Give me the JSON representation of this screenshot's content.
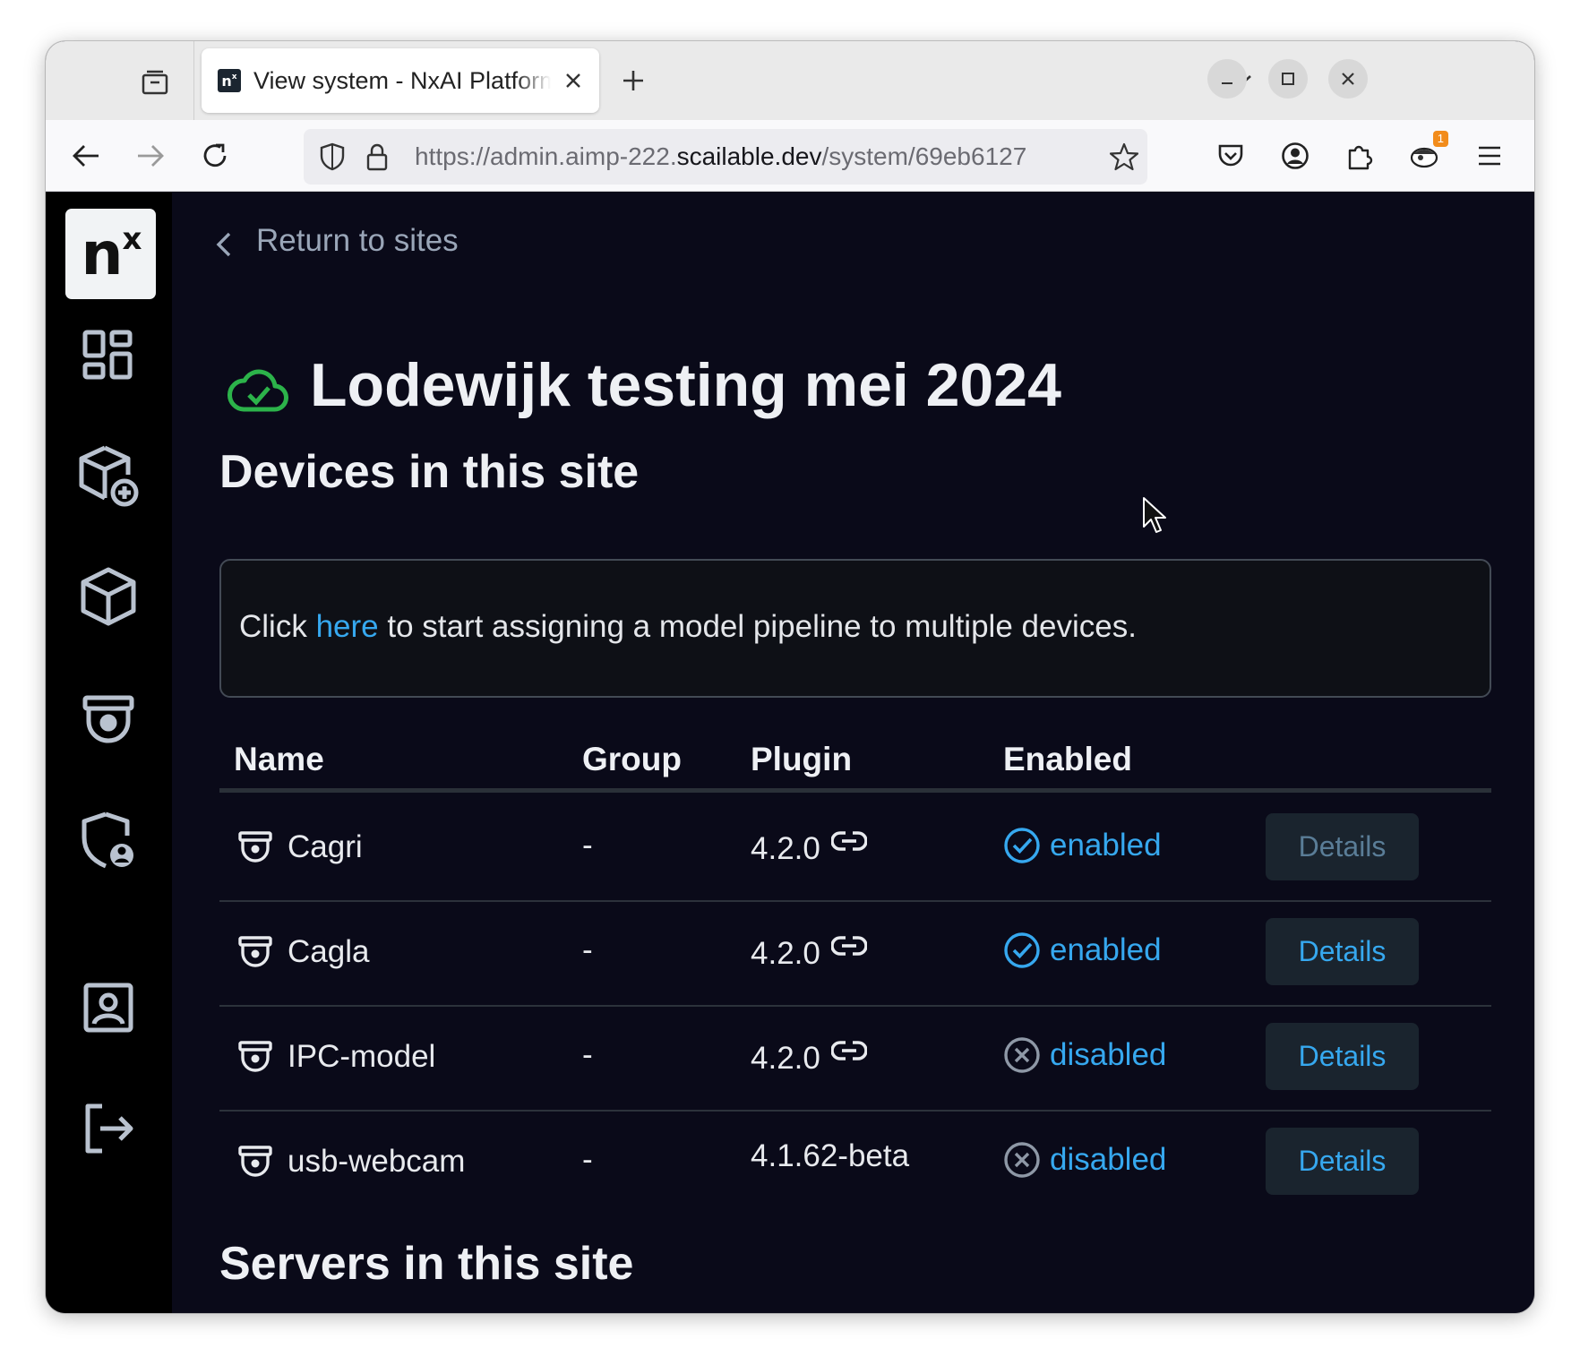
{
  "browser": {
    "tab_title": "View system - NxAI Platform",
    "favicon_text": "n",
    "favicon_sup": "x",
    "url_prefix": "https://admin.aimp-222.",
    "url_host": "scailable.dev",
    "url_path": "/system/69eb6127",
    "extension_badge": "1",
    "icons": {
      "tab_list": "tab-list-icon",
      "close_tab": "close-icon",
      "new_tab": "plus-icon",
      "tabs_dropdown": "chevron-down-icon",
      "minimize": "minimize-icon",
      "maximize": "maximize-icon",
      "close_window": "close-icon",
      "back": "arrow-left-icon",
      "forward": "arrow-right-icon",
      "reload": "reload-icon",
      "shield": "shield-icon",
      "lock": "lock-icon",
      "bookmark": "star-icon",
      "pocket": "pocket-icon",
      "account": "account-icon",
      "extensions": "puzzle-icon",
      "menu": "hamburger-icon"
    }
  },
  "sidebar": {
    "logo_text": "n",
    "logo_sup": "x",
    "items": [
      {
        "name": "dashboard-icon"
      },
      {
        "name": "add-model-icon"
      },
      {
        "name": "models-icon"
      },
      {
        "name": "camera-icon"
      },
      {
        "name": "security-user-icon"
      },
      {
        "name": "account-box-icon"
      },
      {
        "name": "logout-icon"
      }
    ]
  },
  "main": {
    "back_label": "Return to sites",
    "site_title": "Lodewijk testing mei 2024",
    "status_color": "#2cb34a",
    "devices_heading": "Devices in this site",
    "info_prefix": "Click ",
    "info_link": "here",
    "info_suffix": " to start assigning a model pipeline to multiple devices.",
    "columns": [
      "Name",
      "Group",
      "Plugin",
      "Enabled"
    ],
    "devices": [
      {
        "name": "Cagri",
        "group": "-",
        "plugin": "4.2.0",
        "linked": true,
        "status": "enabled",
        "action": "Details"
      },
      {
        "name": "Cagla",
        "group": "-",
        "plugin": "4.2.0",
        "linked": true,
        "status": "enabled",
        "action": "Details"
      },
      {
        "name": "IPC-model",
        "group": "-",
        "plugin": "4.2.0",
        "linked": true,
        "status": "disabled",
        "action": "Details"
      },
      {
        "name": "usb-webcam",
        "group": "-",
        "plugin": "4.1.62-beta",
        "linked": false,
        "status": "disabled",
        "action": "Details"
      }
    ],
    "servers_heading": "Servers in this site",
    "accent_color": "#36a8ef"
  }
}
